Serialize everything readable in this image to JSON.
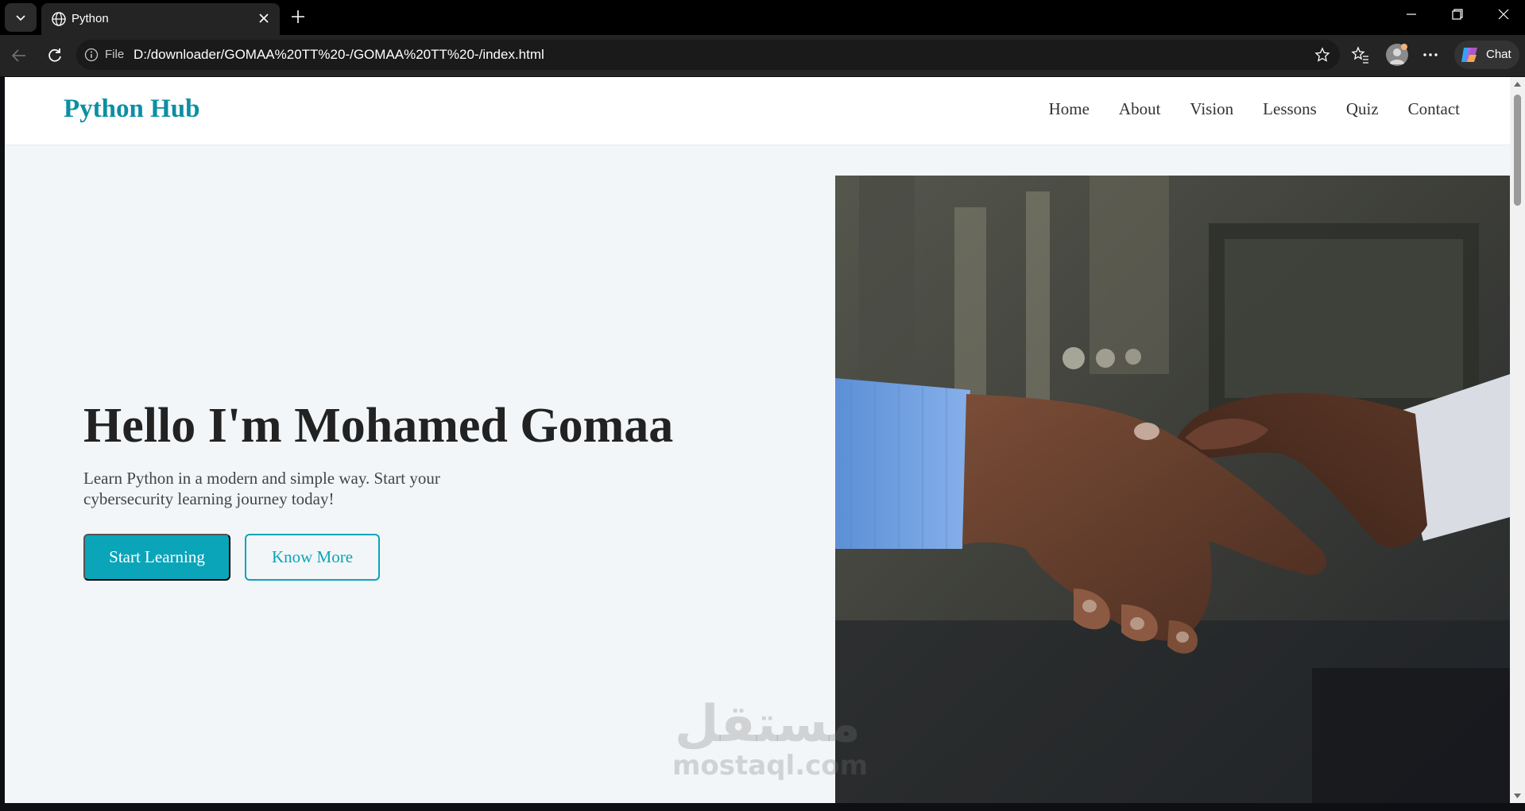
{
  "browser": {
    "tab_title": "Python",
    "file_label": "File",
    "url": "D:/downloader/GOMAA%20TT%20-/GOMAA%20TT%20-/index.html",
    "chat_label": "Chat"
  },
  "site": {
    "brand": "Python Hub",
    "nav": [
      "Home",
      "About",
      "Vision",
      "Lessons",
      "Quiz",
      "Contact"
    ],
    "hero": {
      "title": "Hello I'm Mohamed Gomaa",
      "subtitle": "Learn Python in a modern and simple way. Start your cybersecurity learning journey today!",
      "primary_button": "Start Learning",
      "secondary_button": "Know More",
      "image": "handshake-photo"
    }
  },
  "watermark": {
    "arabic": "مستقل",
    "latin": "mostaql.com"
  },
  "colors": {
    "brand": "#0b8fa3",
    "accent": "#0aa5b9",
    "page_bg": "#f3f6f8",
    "title": "#222222"
  }
}
